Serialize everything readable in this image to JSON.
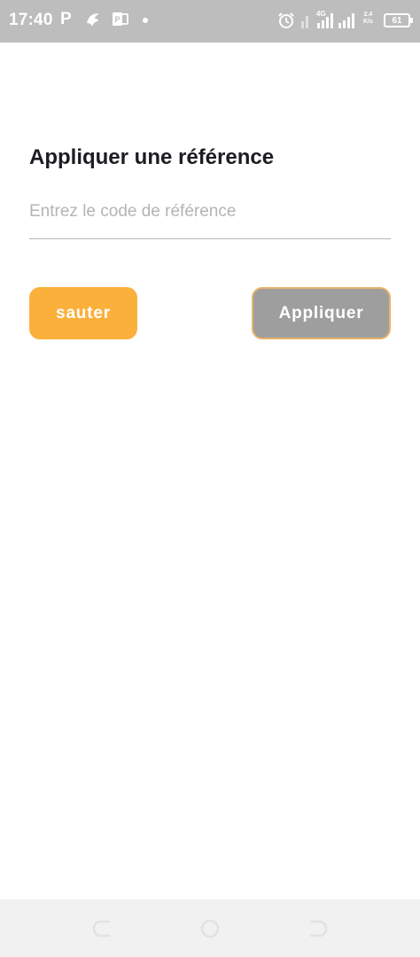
{
  "status_bar": {
    "time": "17:40",
    "notification_letter": "P",
    "icons": [
      "parking-app-icon",
      "bird-app-icon",
      "publisher-app-icon",
      "dot-icon",
      "alarm-icon",
      "signal-icon",
      "signal-4g-icon",
      "signal-icon"
    ],
    "network_label": "4G",
    "speed_value": "2.4",
    "speed_unit": "K/s",
    "battery": "61"
  },
  "page": {
    "title": "Appliquer une référence",
    "referral_input": {
      "placeholder": "Entrez le code de référence",
      "value": ""
    },
    "skip_button": "sauter",
    "apply_button": "Appliquer"
  },
  "colors": {
    "status_bar": "#bdbdbd",
    "skip_button": "#fbb03b",
    "apply_button": "#9e9e9e",
    "apply_border": "#e8b36a",
    "nav_bar": "#f1f1f1"
  },
  "nav_bar": {
    "icons": [
      "back-icon",
      "home-icon",
      "recent-apps-icon"
    ]
  }
}
